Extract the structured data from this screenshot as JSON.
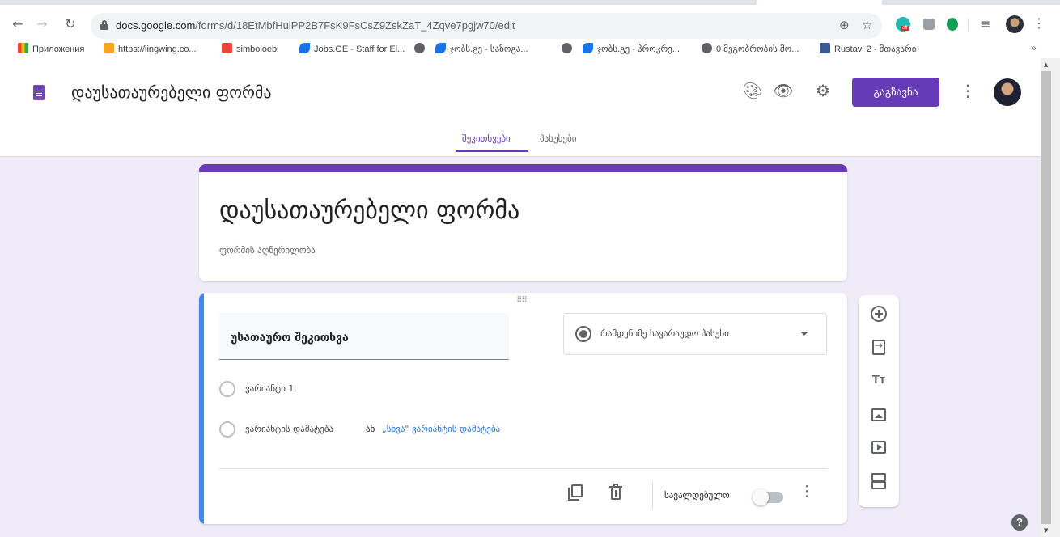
{
  "browser": {
    "url_host": "docs.google.com",
    "url_path": "/forms/d/18EtMbfHuiPP2B7FsK9FsCsZ9ZskZaT_4Zqve7pgjw70/edit",
    "bookmarks": [
      {
        "label": "Приложения",
        "color": "#ea4335"
      },
      {
        "label": "https://lingwing.co...",
        "color": "#f6a623"
      },
      {
        "label": "simboloebi",
        "color": "#e8453c"
      },
      {
        "label": "Jobs.GE - Staff for El...",
        "color": "#1a73e8"
      },
      {
        "label": "",
        "color": "#5f6368"
      },
      {
        "label": "ჯობს.გე - საზოგა...",
        "color": "#1a73e8"
      },
      {
        "label": "",
        "color": "#5f6368"
      },
      {
        "label": "ჯობს.გე - პროკრე...",
        "color": "#1a73e8"
      },
      {
        "label": "0 მეგობრობის მო...",
        "color": "#5f6368"
      },
      {
        "label": "Rustavi 2 - მთავარი",
        "color": "#3b5998"
      }
    ],
    "bookmarks_more": "»",
    "extension_badge": "off"
  },
  "header": {
    "doc_title": "დაუსათაურებელი ფორმა",
    "send_label": "გაგზავნა",
    "tabs": [
      {
        "label": "შეკითხვები",
        "active": true
      },
      {
        "label": "პასუხები",
        "active": false
      }
    ]
  },
  "title_card": {
    "title": "დაუსათაურებელი ფორმა",
    "description": "ფორმის აღწერილობა"
  },
  "question": {
    "title": "უსათაურო შეკითხვა",
    "type": "რამდენიმე სავარაუდო პასუხი",
    "options": [
      "ვარიანტი 1"
    ],
    "add_option": "ვარიანტის დამატება",
    "or": "ან",
    "add_other": "„სხვა\" ვარიანტის დამატება",
    "required_label": "სავალდებულო",
    "required": false
  },
  "help": "?",
  "colors": {
    "accent": "#673ab7",
    "active_question": "#4285f4",
    "background": "#f0ebf8"
  }
}
